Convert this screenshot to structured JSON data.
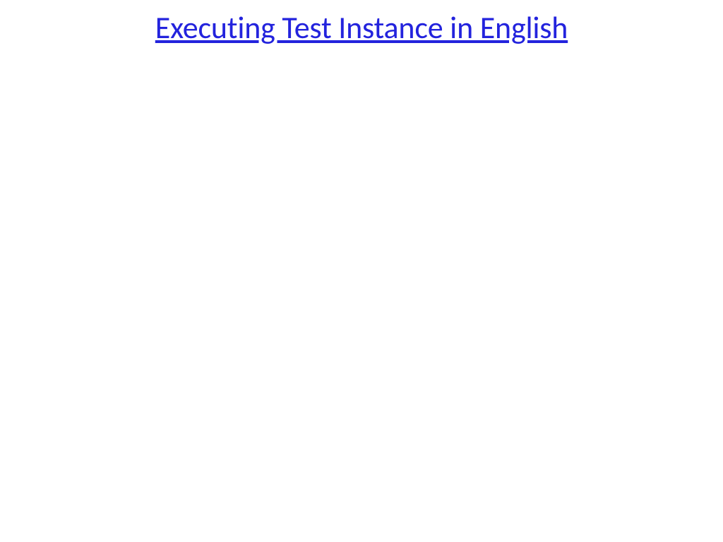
{
  "slide": {
    "title": "Executing Test Instance in English"
  }
}
